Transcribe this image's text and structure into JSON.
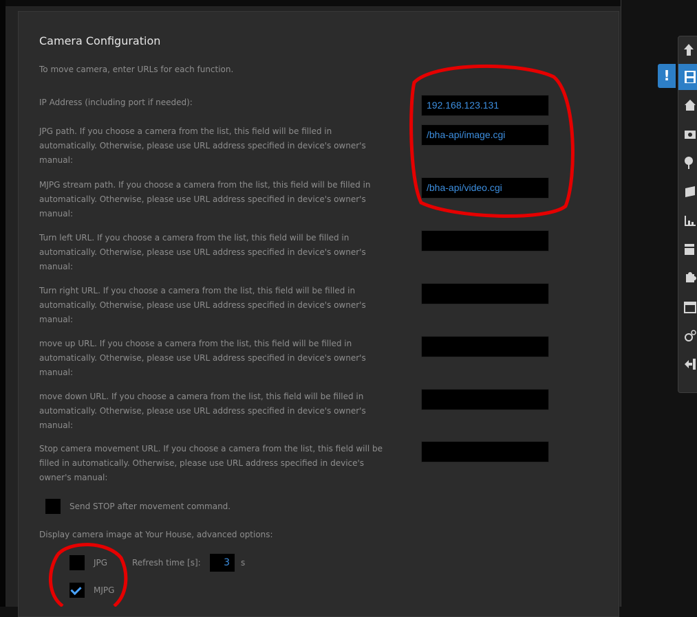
{
  "config": {
    "title": "Camera Configuration",
    "description": "To move camera, enter URLs for each function.",
    "fields": [
      {
        "label": "IP Address (including port if needed):",
        "value": ""
      },
      {
        "label": "JPG path. If you choose a camera from the list, this field will be filled in\nautomatically. Otherwise, please use URL address specified in device's owner's\nmanual:",
        "value": ""
      },
      {
        "label": "MJPG stream path. If you choose a camera from the list, this field will be filled in\nautomatically. Otherwise, please use URL address specified in device's owner's\nmanual:",
        "value": ""
      },
      {
        "label": "Turn left URL. If you choose a camera from the list, this field will be filled in\nautomatically. Otherwise, please use URL address specified in device's owner's\nmanual:",
        "value": ""
      },
      {
        "label": "Turn right URL. If you choose a camera from the list, this field will be filled in\nautomatically. Otherwise, please use URL address specified in device's owner's\nmanual:",
        "value": ""
      },
      {
        "label": "move up URL. If you choose a camera from the list, this field will be filled in\nautomatically. Otherwise, please use URL address specified in device's owner's\nmanual:",
        "value": ""
      },
      {
        "label": "move down URL. If you choose a camera from the list, this field will be filled in\nautomatically. Otherwise, please use URL address specified in device's owner's\nmanual:",
        "value": ""
      },
      {
        "label": "Stop camera movement URL. If you choose a camera from the list, this field will be\nfilled in automatically. Otherwise, please use URL address specified in device's\nowner's manual:",
        "value": ""
      }
    ],
    "field_values": {
      "ip": "192.168.123.131",
      "jpg": "/bha-api/image.cgi",
      "mjpg": "/bha-api/video.cgi"
    },
    "send_stop_label": "Send STOP after movement command.",
    "send_stop_checked": false,
    "display_label": "Display camera image at Your House, advanced options:",
    "jpg_option_label": "JPG",
    "jpg_checked": false,
    "refresh_label": "Refresh time [s]:",
    "refresh_value": "3",
    "refresh_unit": "s",
    "mjpg_option_label": "MJPG",
    "mjpg_checked": true
  },
  "toolbar": {
    "alert_badge": "!",
    "items": [
      "up-arrow-icon",
      "save-icon",
      "home-icon",
      "camera-icon",
      "pin-icon",
      "flag-icon",
      "chart-icon",
      "tray-icon",
      "puzzle-icon",
      "calendar-icon",
      "gears-icon",
      "logout-icon"
    ],
    "active_index": 1
  },
  "colors": {
    "accent": "#2d7fc7",
    "input_text": "#3d8fe0",
    "annotation": "#e50000"
  }
}
